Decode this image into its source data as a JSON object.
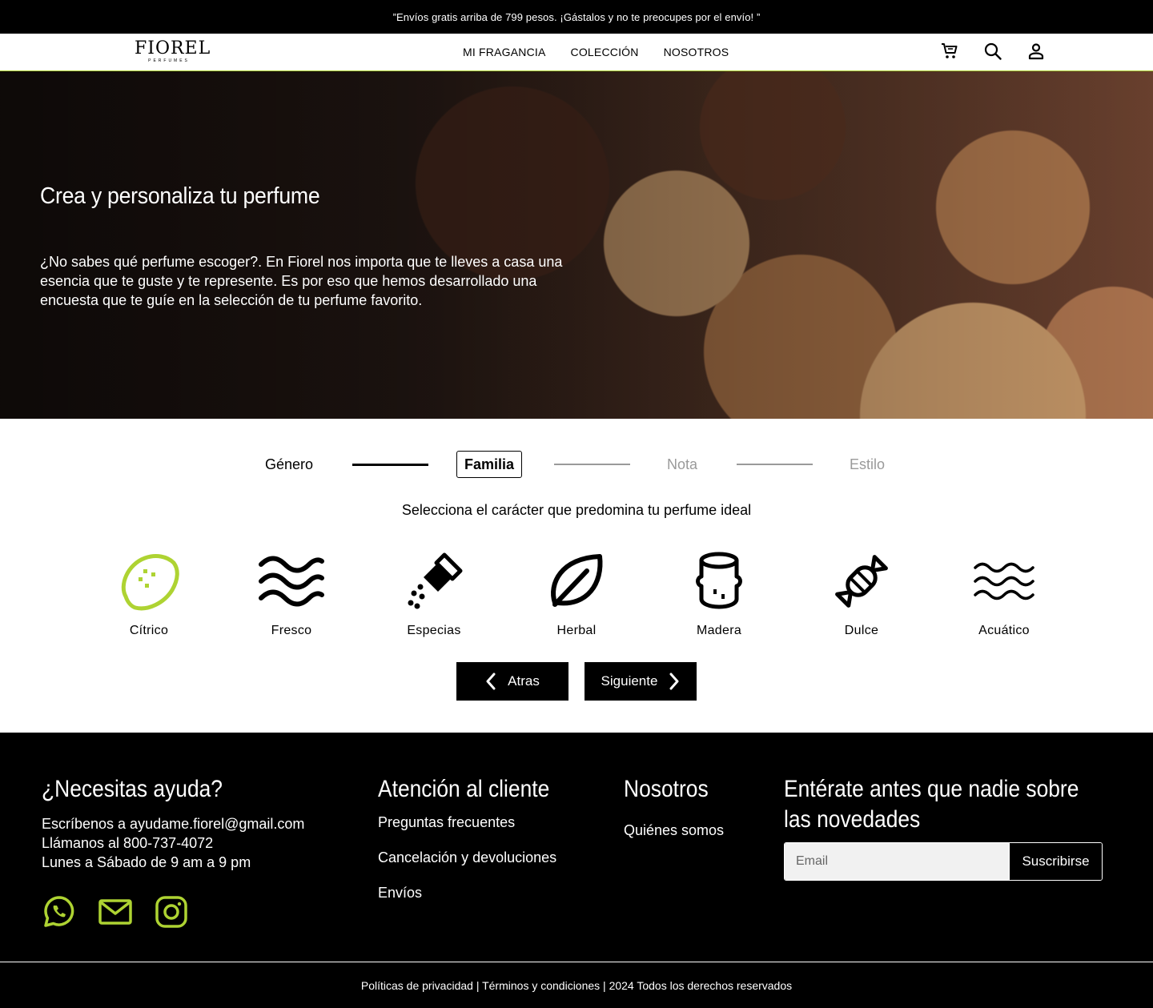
{
  "announcement": {
    "text": "”Envíos gratis arriba de 799 pesos. ¡Gástalos y no te preocupes por el envío! ”"
  },
  "brand": {
    "name": "FIOREL",
    "tagline": "PERFUMES"
  },
  "nav": {
    "links": [
      "MI FRAGANCIA",
      "COLECCIÓN",
      "NOSOTROS"
    ],
    "icons": [
      "cart-icon",
      "search-icon",
      "user-icon"
    ]
  },
  "hero": {
    "title": "Crea y personaliza tu perfume",
    "text": "¿No sabes qué perfume escoger?. En Fiorel nos importa que te lleves a casa una esencia que te guste y te represente. Es por eso que hemos desarrollado una encuesta que te guíe en la selección de tu perfume favorito."
  },
  "quiz": {
    "steps": [
      {
        "label": "Género",
        "state": "done"
      },
      {
        "label": "Familia",
        "state": "active"
      },
      {
        "label": "Nota",
        "state": "todo"
      },
      {
        "label": "Estilo",
        "state": "todo"
      }
    ],
    "prompt": "Selecciona el carácter que predomina tu perfume ideal",
    "options": [
      {
        "label": "Cítrico",
        "icon": "lemon-icon",
        "selected": true
      },
      {
        "label": "Fresco",
        "icon": "waves-icon",
        "selected": false
      },
      {
        "label": "Especias",
        "icon": "spice-shaker-icon",
        "selected": false
      },
      {
        "label": "Herbal",
        "icon": "leaf-icon",
        "selected": false
      },
      {
        "label": "Madera",
        "icon": "wood-log-icon",
        "selected": false
      },
      {
        "label": "Dulce",
        "icon": "candy-icon",
        "selected": false
      },
      {
        "label": "Acuático",
        "icon": "water-icon",
        "selected": false
      }
    ],
    "back_label": "Atras",
    "next_label": "Siguiente"
  },
  "footer": {
    "help": {
      "title": "¿Necesitas ayuda?",
      "lines": [
        "Escríbenos a ayudame.fiorel@gmail.com",
        "Llámanos al 800-737-4072",
        "Lunes a Sábado de 9 am a 9 pm"
      ],
      "social": [
        "whatsapp-icon",
        "mail-icon",
        "instagram-icon"
      ]
    },
    "customer": {
      "title": "Atención al cliente",
      "links": [
        "Preguntas frecuentes",
        "Cancelación y devoluciones",
        "Envíos"
      ]
    },
    "about": {
      "title": "Nosotros",
      "links": [
        "Quiénes somos"
      ]
    },
    "newsletter": {
      "title": "Entérate antes que nadie sobre las novedades",
      "placeholder": "Email",
      "button": "Suscribirse"
    },
    "legal": "Políticas de privacidad | Términos y condiciones | 2024 Todos los derechos reservados"
  },
  "colors": {
    "accent": "#aed332",
    "background": "#ffffff",
    "dark": "#000000",
    "muted": "#9a9a9a"
  }
}
